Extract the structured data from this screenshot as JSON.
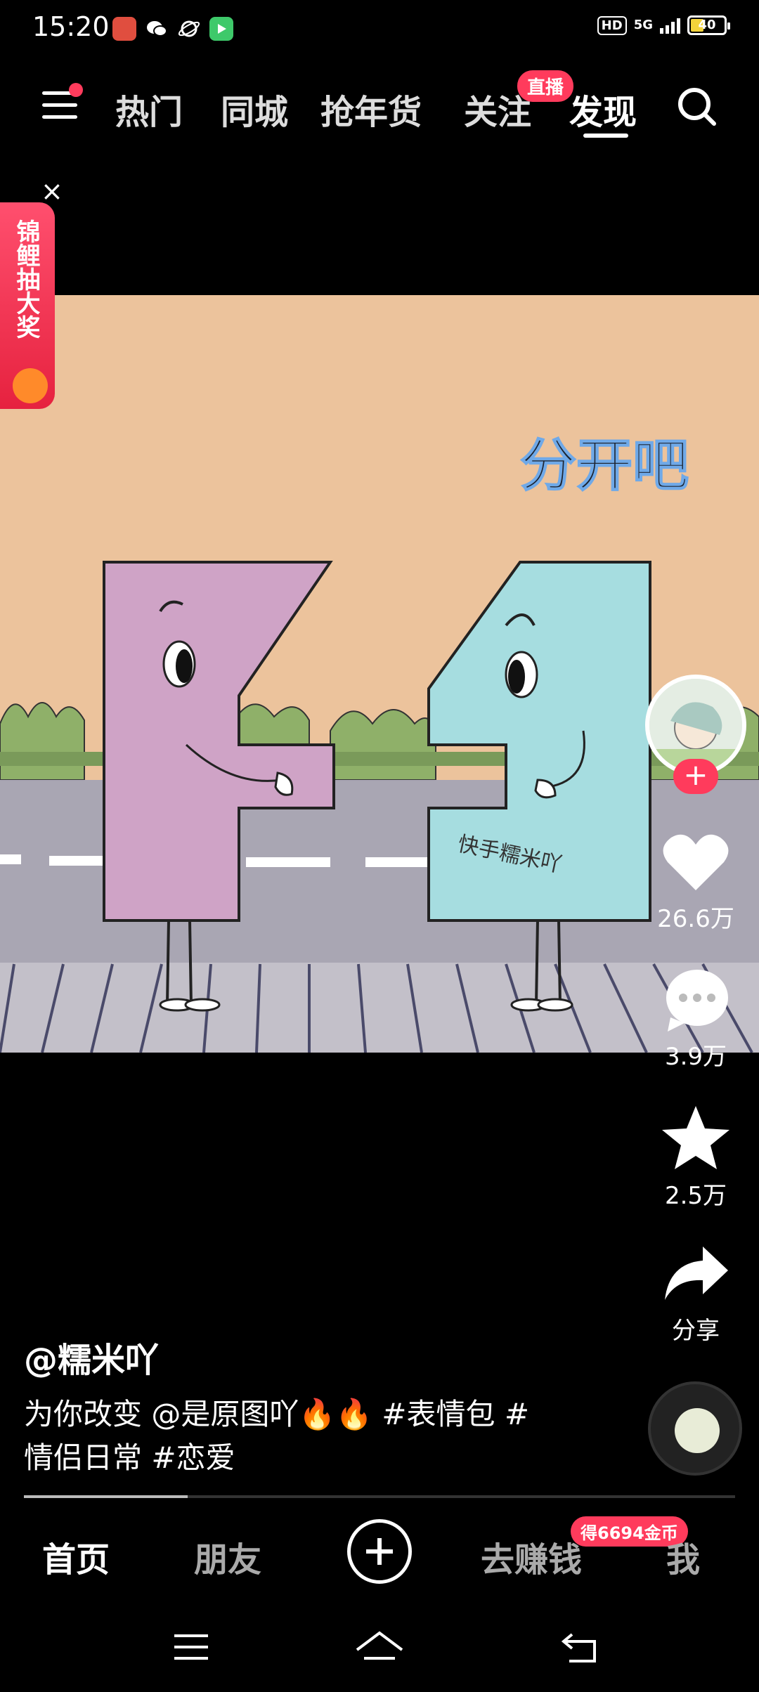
{
  "status_bar": {
    "time": "15:20",
    "hd": "HD",
    "network": "5G",
    "battery": "40",
    "battery_level": 0.4,
    "app_icons": [
      "video-app-icon",
      "wechat-icon",
      "planet-icon",
      "player-app-icon"
    ]
  },
  "top_nav": {
    "tabs": [
      "热门",
      "同城",
      "抢年货",
      "关注",
      "发现"
    ],
    "active_tab": "发现",
    "live_badge": "直播",
    "menu_icon": "menu-icon",
    "search_icon": "search-icon"
  },
  "promo": {
    "label": "锦鲤抽大奖",
    "close_symbol": "×"
  },
  "video": {
    "overlay_text": "分开吧",
    "watermark": "快手糯米吖"
  },
  "actions": {
    "likes": "26.6万",
    "comments": "3.9万",
    "favorites": "2.5万",
    "share": "分享",
    "follow_symbol": "+"
  },
  "post": {
    "author": "@糯米吖",
    "caption_line1": "为你改变 @是原图吖🔥🔥 #表情包 #",
    "caption_line2": "情侣日常 #恋爱",
    "progress": 0.23
  },
  "bottom_nav": {
    "items": [
      "首页",
      "朋友",
      "去赚钱",
      "我"
    ],
    "active": "首页",
    "coin_badge": "得6694金币"
  },
  "colors": {
    "accent": "#ff3b5c",
    "video_background": "#ecc39c",
    "pink_character": "#cfa3c6",
    "blue_character": "#a6dde0",
    "road": "#a9a6b3"
  }
}
